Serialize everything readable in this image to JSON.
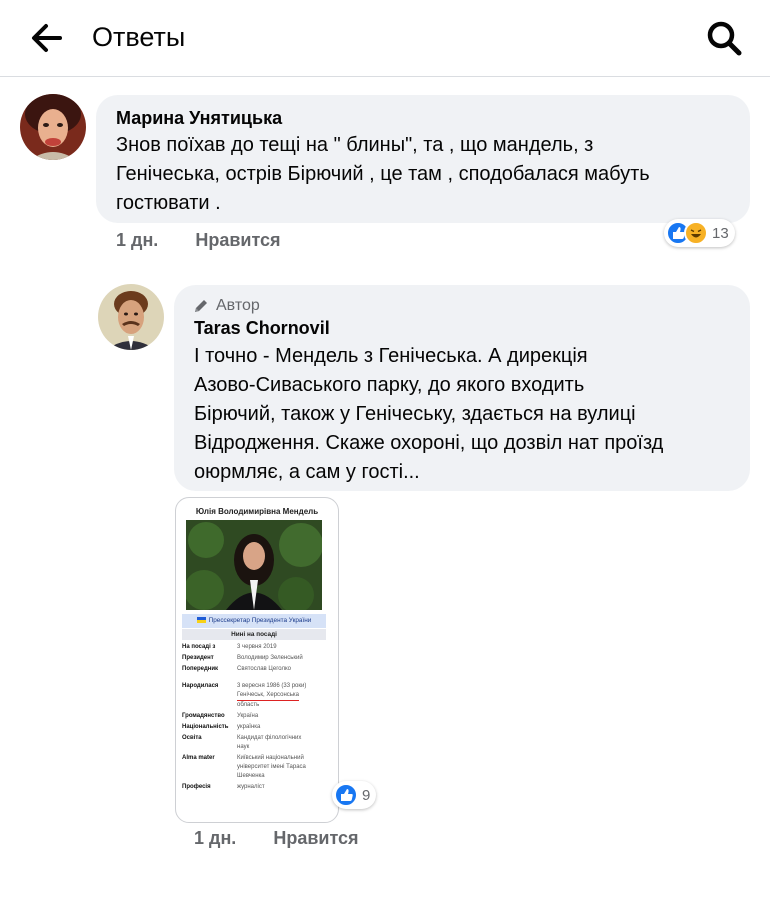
{
  "header": {
    "title": "Ответы",
    "back_icon": "arrow-left-icon",
    "search_icon": "search-icon"
  },
  "comments": [
    {
      "author": "Марина Унятицька",
      "text": "Знов поїхав до тещі на \" блины\", та , що мандель, з\nГенічеська, острів Бірючий , це там , сподобалася мабуть\nгостювати .",
      "time": "1 дн.",
      "like_label": "Нравится",
      "reaction_count": "13",
      "reactions": [
        "like-icon",
        "haha-icon"
      ]
    },
    {
      "badge": "Автор",
      "badge_icon": "pencil-icon",
      "author": "Taras Chornovil",
      "text": "І точно - Мендель з Генічеська. А дирекція\nАзово-Сиваського парку, до якого входить\nБірючий, також у Генічеську, здається на вулиці\nВідродження. Скаже охороні, що дозвіл нат проїзд\nоюрмляє, а сам  у гості...",
      "time": "1 дн.",
      "like_label": "Нравится",
      "reaction_count": "9",
      "reactions": [
        "like-icon"
      ]
    }
  ],
  "attachment": {
    "title": "Юлія Володимирівна Мендель",
    "role": "Прессекретар Президента України",
    "sub": "Нині на посаді",
    "rows": [
      {
        "k": "На посаді з",
        "v": "3 червня 2019"
      },
      {
        "k": "Президент",
        "v": "Володимир Зеленський"
      },
      {
        "k": "Попередник",
        "v": "Святослав Цеголко"
      },
      {
        "k": "Народилася",
        "v": "3 вересня 1986 (33 роки)",
        "v2": "Генічеськ, Херсонська",
        "v3": "область"
      },
      {
        "k": "Громадянство",
        "v": "Україна"
      },
      {
        "k": "Національність",
        "v": "українка"
      },
      {
        "k": "Освіта",
        "v": "Кандидат філологічних",
        "v2": "наук"
      },
      {
        "k": "Alma mater",
        "v": "Київський національний",
        "v2": "університет імені Тараса",
        "v3": "Шевченка"
      },
      {
        "k": "Професія",
        "v": "журналіст"
      }
    ]
  },
  "colors": {
    "like_blue": "#1877f2",
    "haha_yellow": "#f7b125",
    "bubble": "#f0f2f5",
    "meta": "#65676b"
  }
}
